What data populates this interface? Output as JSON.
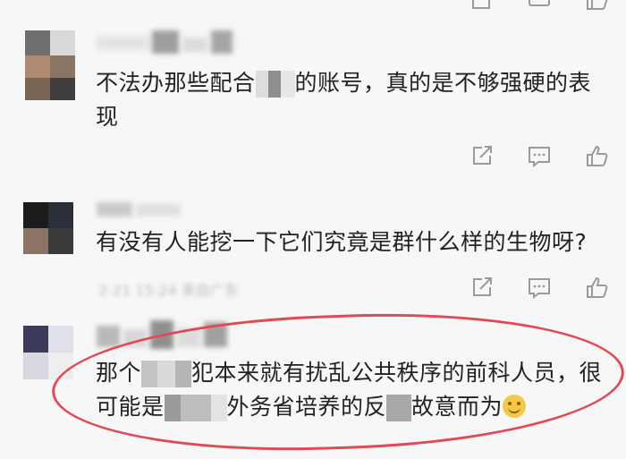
{
  "comments": [
    {
      "text_before": "不法办那些配合",
      "text_after": "的账号，真的是不够强硬的表",
      "text_line2": "现",
      "meta": ""
    },
    {
      "text": "有没有人能挖一下它们究竟是群什么样的生物呀?",
      "meta": "2-21 15:24 来自广东"
    },
    {
      "text_line1_a": "那个",
      "text_line1_b": "犯本来就有扰乱公共秩序的前科人员，很",
      "text_line2_a": "可能是",
      "text_line2_b": "外务省培养的反",
      "text_line2_c": "故意而为",
      "emoji": "smile-emoji"
    }
  ],
  "icons": [
    "share-icon",
    "comment-icon",
    "like-icon"
  ],
  "colors": {
    "highlight_ring": "#e14a55",
    "icon": "#9a9a9a",
    "text": "#222222"
  }
}
